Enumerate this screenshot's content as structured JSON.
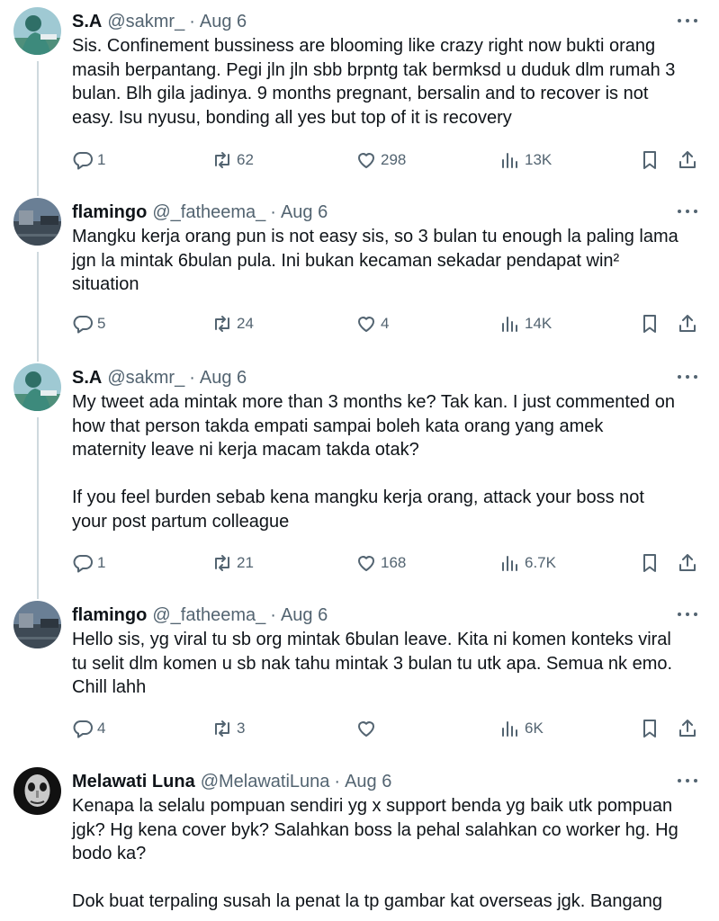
{
  "tweets": [
    {
      "name": "S.A",
      "handle": "@sakmr_",
      "dot": "·",
      "date": "Aug 6",
      "text": "Sis. Confinement bussiness are blooming like crazy right now bukti orang\nmasih berpantang. Pegi jln jln sbb brpntg tak bermksd u duduk dlm rumah 3\nbulan. Blh gila jadinya. 9 months pregnant, bersalin and to recover is not\neasy. Isu nyusu, bonding all yes but top of it is recovery",
      "replies": "1",
      "retweets": "62",
      "likes": "298",
      "views": "13K"
    },
    {
      "name": "flamingo",
      "handle": "@_fatheema_",
      "dot": "·",
      "date": "Aug 6",
      "text": "Mangku kerja orang pun is not easy sis, so 3 bulan tu enough la paling lama\njgn la mintak 6bulan pula. Ini bukan kecaman sekadar pendapat win²\nsituation",
      "replies": "5",
      "retweets": "24",
      "likes": "4",
      "views": "14K"
    },
    {
      "name": "S.A",
      "handle": "@sakmr_",
      "dot": "·",
      "date": "Aug 6",
      "text": "My tweet ada mintak more than 3 months ke? Tak kan. I just commented on\nhow that person takda empati sampai boleh kata orang yang amek\nmaternity leave ni kerja macam takda otak?\n\nIf you feel burden sebab kena mangku kerja orang, attack your boss not\nyour post partum colleague",
      "replies": "1",
      "retweets": "21",
      "likes": "168",
      "views": "6.7K"
    },
    {
      "name": "flamingo",
      "handle": "@_fatheema_",
      "dot": "·",
      "date": "Aug 6",
      "text": "Hello sis, yg viral tu sb org mintak 6bulan leave. Kita ni komen konteks viral\ntu selit dlm komen u sb nak tahu mintak 3 bulan tu utk apa. Semua nk emo.\nChill lahh",
      "replies": "4",
      "retweets": "3",
      "likes": "",
      "views": "6K"
    },
    {
      "name": "Melawati Luna",
      "handle": "@MelawatiLuna",
      "dot": "·",
      "date": "Aug 6",
      "text": "Kenapa la selalu pompuan sendiri yg x support benda yg baik utk pompuan\njgk? Hg kena cover byk? Salahkan boss la pehal salahkan co worker hg. Hg\nbodo ka?\n\nDok buat terpaling susah la penat la tp gambar kat overseas jgk. Bangang"
    }
  ],
  "icons": {
    "reply": "reply-icon",
    "retweet": "retweet-icon",
    "like": "like-icon",
    "views": "views-icon",
    "bookmark": "bookmark-icon",
    "share": "share-icon",
    "more": "more-icon"
  },
  "colors": {
    "text": "#0f1419",
    "secondary": "#536471",
    "thread_line": "#cfd9de"
  }
}
